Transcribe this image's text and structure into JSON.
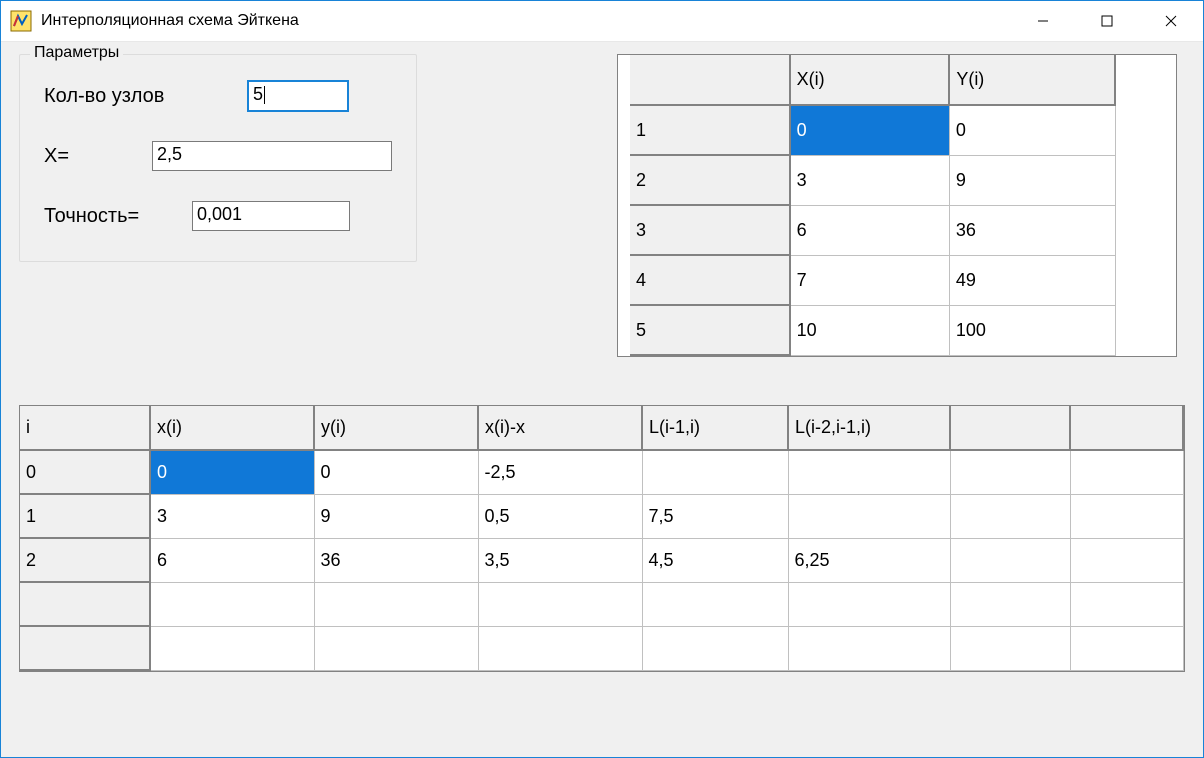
{
  "window": {
    "title": "Интерполяционная схема Эйткена"
  },
  "params": {
    "legend": "Параметры",
    "nodes_label": "Кол-во узлов",
    "nodes_value": "5",
    "x_label": "X=",
    "x_value": "2,5",
    "precision_label": "Точность=",
    "precision_value": "0,001"
  },
  "top_grid": {
    "headers": {
      "c0": "",
      "c1": "X(i)",
      "c2": "Y(i)"
    },
    "rows": [
      {
        "idx": "1",
        "x": "0",
        "y": "0"
      },
      {
        "idx": "2",
        "x": "3",
        "y": "9"
      },
      {
        "idx": "3",
        "x": "6",
        "y": "36"
      },
      {
        "idx": "4",
        "x": "7",
        "y": "49"
      },
      {
        "idx": "5",
        "x": "10",
        "y": "100"
      }
    ]
  },
  "bottom_grid": {
    "headers": {
      "c0": "i",
      "c1": "x(i)",
      "c2": "y(i)",
      "c3": "x(i)-x",
      "c4": "L(i-1,i)",
      "c5": "L(i-2,i-1,i)",
      "c6": "",
      "c7": ""
    },
    "rows": [
      {
        "c0": "0",
        "c1": "0",
        "c2": "0",
        "c3": "-2,5",
        "c4": "",
        "c5": "",
        "c6": "",
        "c7": ""
      },
      {
        "c0": "1",
        "c1": "3",
        "c2": "9",
        "c3": "0,5",
        "c4": "7,5",
        "c5": "",
        "c6": "",
        "c7": ""
      },
      {
        "c0": "2",
        "c1": "6",
        "c2": "36",
        "c3": "3,5",
        "c4": "4,5",
        "c5": "6,25",
        "c6": "",
        "c7": ""
      },
      {
        "c0": "",
        "c1": "",
        "c2": "",
        "c3": "",
        "c4": "",
        "c5": "",
        "c6": "",
        "c7": ""
      },
      {
        "c0": "",
        "c1": "",
        "c2": "",
        "c3": "",
        "c4": "",
        "c5": "",
        "c6": "",
        "c7": ""
      }
    ]
  }
}
